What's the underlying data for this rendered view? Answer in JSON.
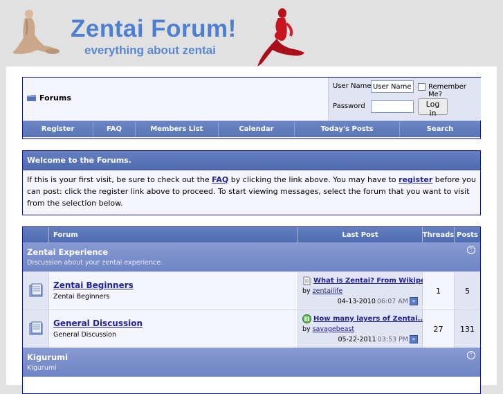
{
  "header": {
    "title": "Zentai Forum!",
    "subtitle": "everything about zentai"
  },
  "navbar": {
    "breadcrumb": "Forums",
    "username_label": "User Name",
    "username_value": "User Name",
    "remember_label": "Remember Me?",
    "password_label": "Password",
    "login_button": "Log in",
    "links": [
      "Register",
      "FAQ",
      "Members List",
      "Calendar",
      "Today's Posts",
      "Search"
    ]
  },
  "welcome": {
    "title": "Welcome to the Forums.",
    "text_1": "If this is your first visit, be sure to check out the ",
    "faq_link": "FAQ",
    "text_2": " by clicking the link above. You may have to ",
    "register_link": "register",
    "text_3": " before you can post: click the register link above to proceed. To start viewing messages, select the forum that you want to visit from the selection below."
  },
  "forum_table": {
    "headers": {
      "forum": "Forum",
      "last_post": "Last Post",
      "threads": "Threads",
      "posts": "Posts"
    },
    "categories": [
      {
        "title": "Zentai Experience",
        "description": "Discussion about your zentai experience."
      },
      {
        "title": "Kigurumi",
        "description": "Kigurumi"
      }
    ],
    "forums": [
      {
        "name": "Zentai Beginners",
        "description": "Zentai Beginners",
        "last_post_title": "What is Zentai? From Wikipedia",
        "by_label": "by",
        "last_post_user": "zentailife",
        "last_post_date": "04-13-2010",
        "last_post_time": "06:07 AM",
        "threads": "1",
        "posts": "5"
      },
      {
        "name": "General Discussion",
        "description": "General Discussion",
        "last_post_title": "How many layers of Zentai...",
        "by_label": "by",
        "last_post_user": "savagebeast",
        "last_post_date": "05-22-2011",
        "last_post_time": "03:53 PM",
        "threads": "27",
        "posts": "131"
      }
    ]
  }
}
